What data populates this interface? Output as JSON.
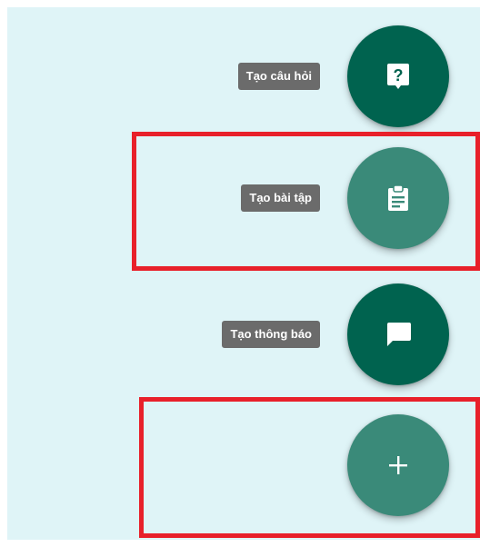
{
  "fab_menu": {
    "items": [
      {
        "label": "Tạo câu hỏi",
        "icon": "question-icon",
        "color": "#00634f"
      },
      {
        "label": "Tạo bài tập",
        "icon": "assignment-icon",
        "color": "#3a8a79"
      },
      {
        "label": "Tạo thông báo",
        "icon": "announcement-icon",
        "color": "#00634f"
      }
    ],
    "main_button": {
      "icon": "plus-icon",
      "color": "#3a8a79"
    }
  },
  "colors": {
    "background": "#dff4f7",
    "tooltip_bg": "#6b6b6b",
    "highlight_red": "#e8202a"
  }
}
